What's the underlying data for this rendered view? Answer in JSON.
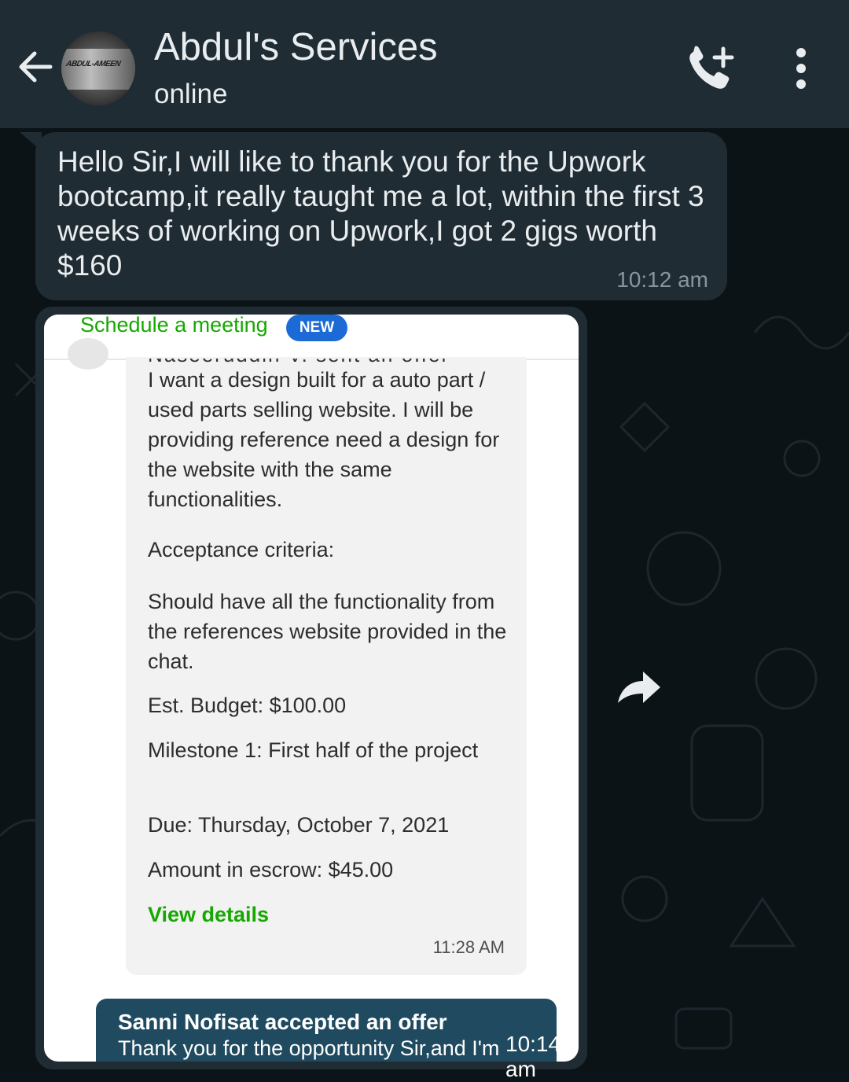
{
  "header": {
    "title": "Abdul's Services",
    "status": "online",
    "avatar_text": "ABDUL-AMEEN"
  },
  "messages": {
    "text_message": {
      "text": "Hello Sir,I will like to thank you for the Upwork bootcamp,it really taught me a lot, within the first 3 weeks of working on Upwork,I got 2 gigs worth $160",
      "time": "10:12 am"
    },
    "image_message": {
      "time": "10:14 am",
      "screenshot": {
        "schedule_label": "Schedule a meeting",
        "new_badge": "NEW",
        "cut_line": "Naseeruddin V. sent an offer",
        "description": "I want a design built for a auto part / used parts selling website. I will be providing reference need a design for the website with the same functionalities.",
        "acceptance_label": "Acceptance criteria:",
        "acceptance_text": "Should have all the functionality from the references website provided in the chat.",
        "budget": "Est. Budget: $100.00",
        "milestone": "Milestone 1: First half of the project",
        "due": "Due: Thursday, October 7, 2021",
        "escrow": "Amount in escrow: $45.00",
        "view_details": "View details",
        "card_time": "11:28 AM",
        "banner_title": "Sanni Nofisat accepted an offer",
        "banner_text": "Thank you for the opportunity Sir,and I'm"
      }
    }
  },
  "icons": {
    "back": "arrow-left-icon",
    "call_add": "phone-plus-icon",
    "menu": "more-vertical-icon",
    "forward": "forward-share-icon"
  },
  "colors": {
    "header_bg": "#1f2c34",
    "bubble_bg": "#202c33",
    "upwork_green": "#14a800",
    "badge_blue": "#1c6ad6"
  }
}
